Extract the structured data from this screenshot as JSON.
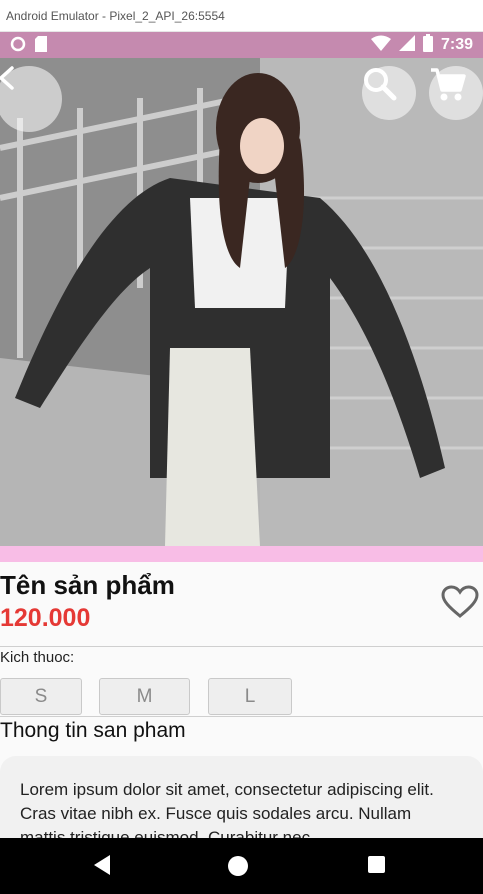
{
  "window": {
    "title": "Android Emulator - Pixel_2_API_26:5554"
  },
  "status_bar": {
    "time": "7:39",
    "icons": [
      "circle-icon",
      "sd-card-icon",
      "wifi-icon",
      "signal-icon",
      "battery-icon"
    ]
  },
  "app_bar": {
    "back_icon": "chevron-left-icon",
    "search_icon": "search-icon",
    "cart_icon": "shopping-cart-icon"
  },
  "product": {
    "name": "Tên sản phẩm",
    "price": "120.000",
    "favorite_icon": "heart-outline-icon"
  },
  "sizes": {
    "label": "Kich thuoc:",
    "options": [
      "S",
      "M",
      "L"
    ]
  },
  "info": {
    "title": "Thong tin san pham",
    "description": "Lorem ipsum dolor sit amet, consectetur adipiscing elit. Cras vitae nibh ex. Fusce quis sodales arcu. Nullam mattis tristique euismod. Curabitur nec"
  },
  "colors": {
    "status_bar": "#c58aaf",
    "accent_strip": "#f8bde6",
    "price": "#e53935"
  },
  "nav_bar": {
    "icons": [
      "back-triangle-icon",
      "home-circle-icon",
      "recent-square-icon"
    ]
  }
}
